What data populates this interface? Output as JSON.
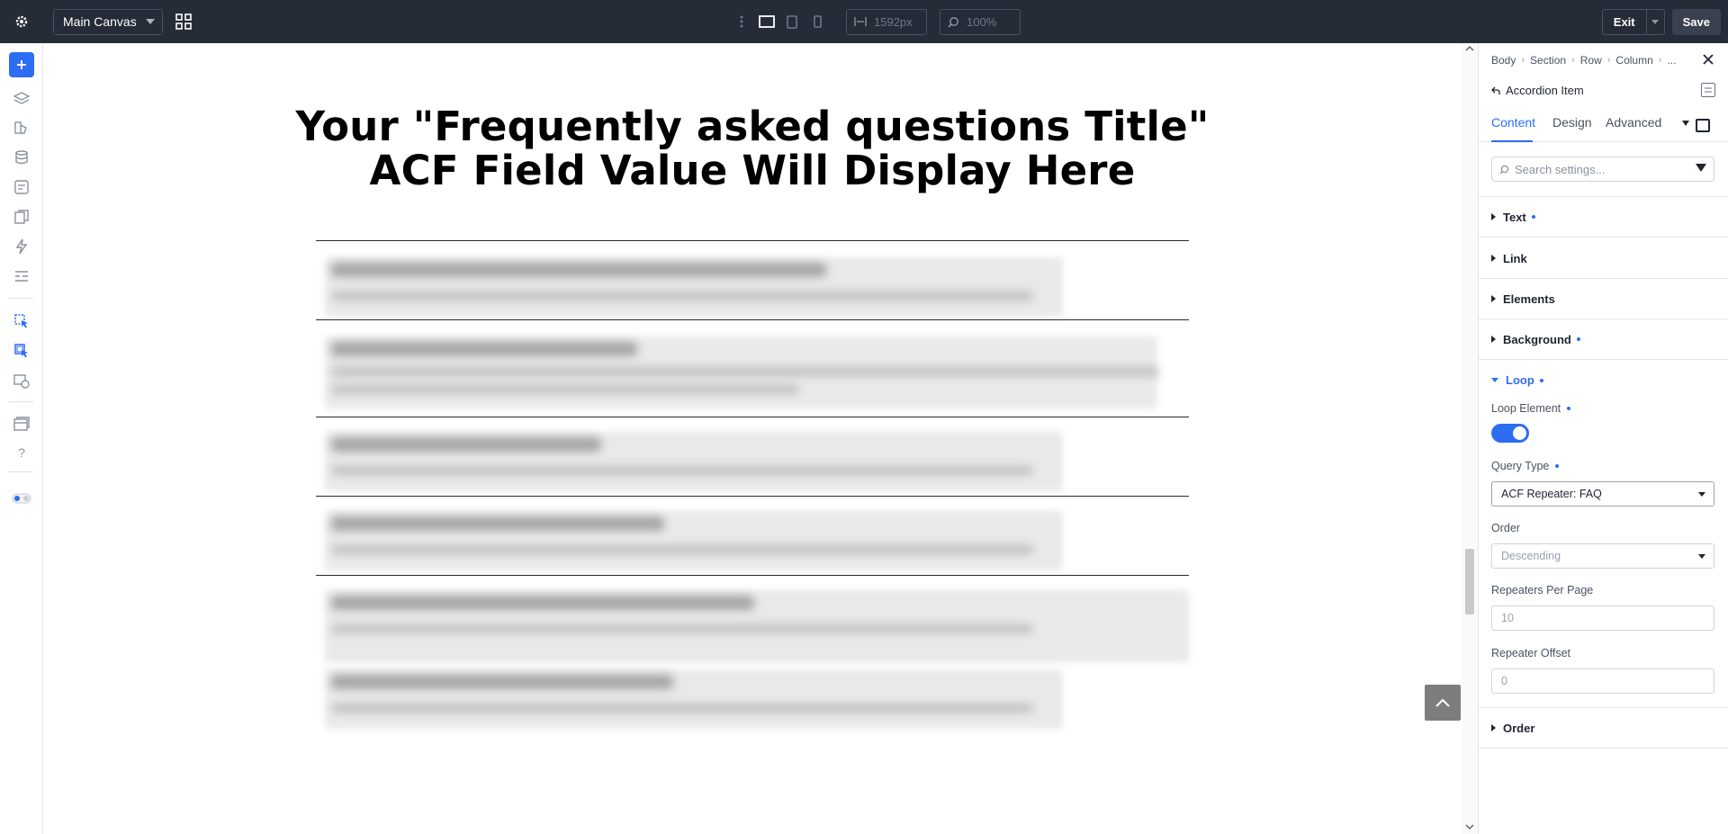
{
  "topbar": {
    "canvas_select": "Main Canvas",
    "width_value": "1592px",
    "zoom_value": "100%",
    "exit_label": "Exit",
    "save_label": "Save"
  },
  "canvas": {
    "title_line1": "Your \"Frequently asked questions Title\"",
    "title_line2": "ACF Field Value Will Display Here"
  },
  "panel": {
    "breadcrumb": [
      "Body",
      "Section",
      "Row",
      "Column",
      "..."
    ],
    "element_name": "Accordion Item",
    "tabs": [
      "Content",
      "Design",
      "Advanced"
    ],
    "search_placeholder": "Search settings...",
    "sections": {
      "text": "Text",
      "link": "Link",
      "elements": "Elements",
      "background": "Background",
      "loop": "Loop",
      "order": "Order"
    },
    "loop": {
      "loop_element_label": "Loop Element",
      "loop_element_enabled": true,
      "query_type_label": "Query Type",
      "query_type_value": "ACF Repeater: FAQ",
      "order_label": "Order",
      "order_value": "Descending",
      "per_page_label": "Repeaters Per Page",
      "per_page_value": "10",
      "offset_label": "Repeater Offset",
      "offset_value": "0"
    }
  },
  "colors": {
    "accent": "#2c6df2",
    "topbar_bg": "#262c37"
  }
}
